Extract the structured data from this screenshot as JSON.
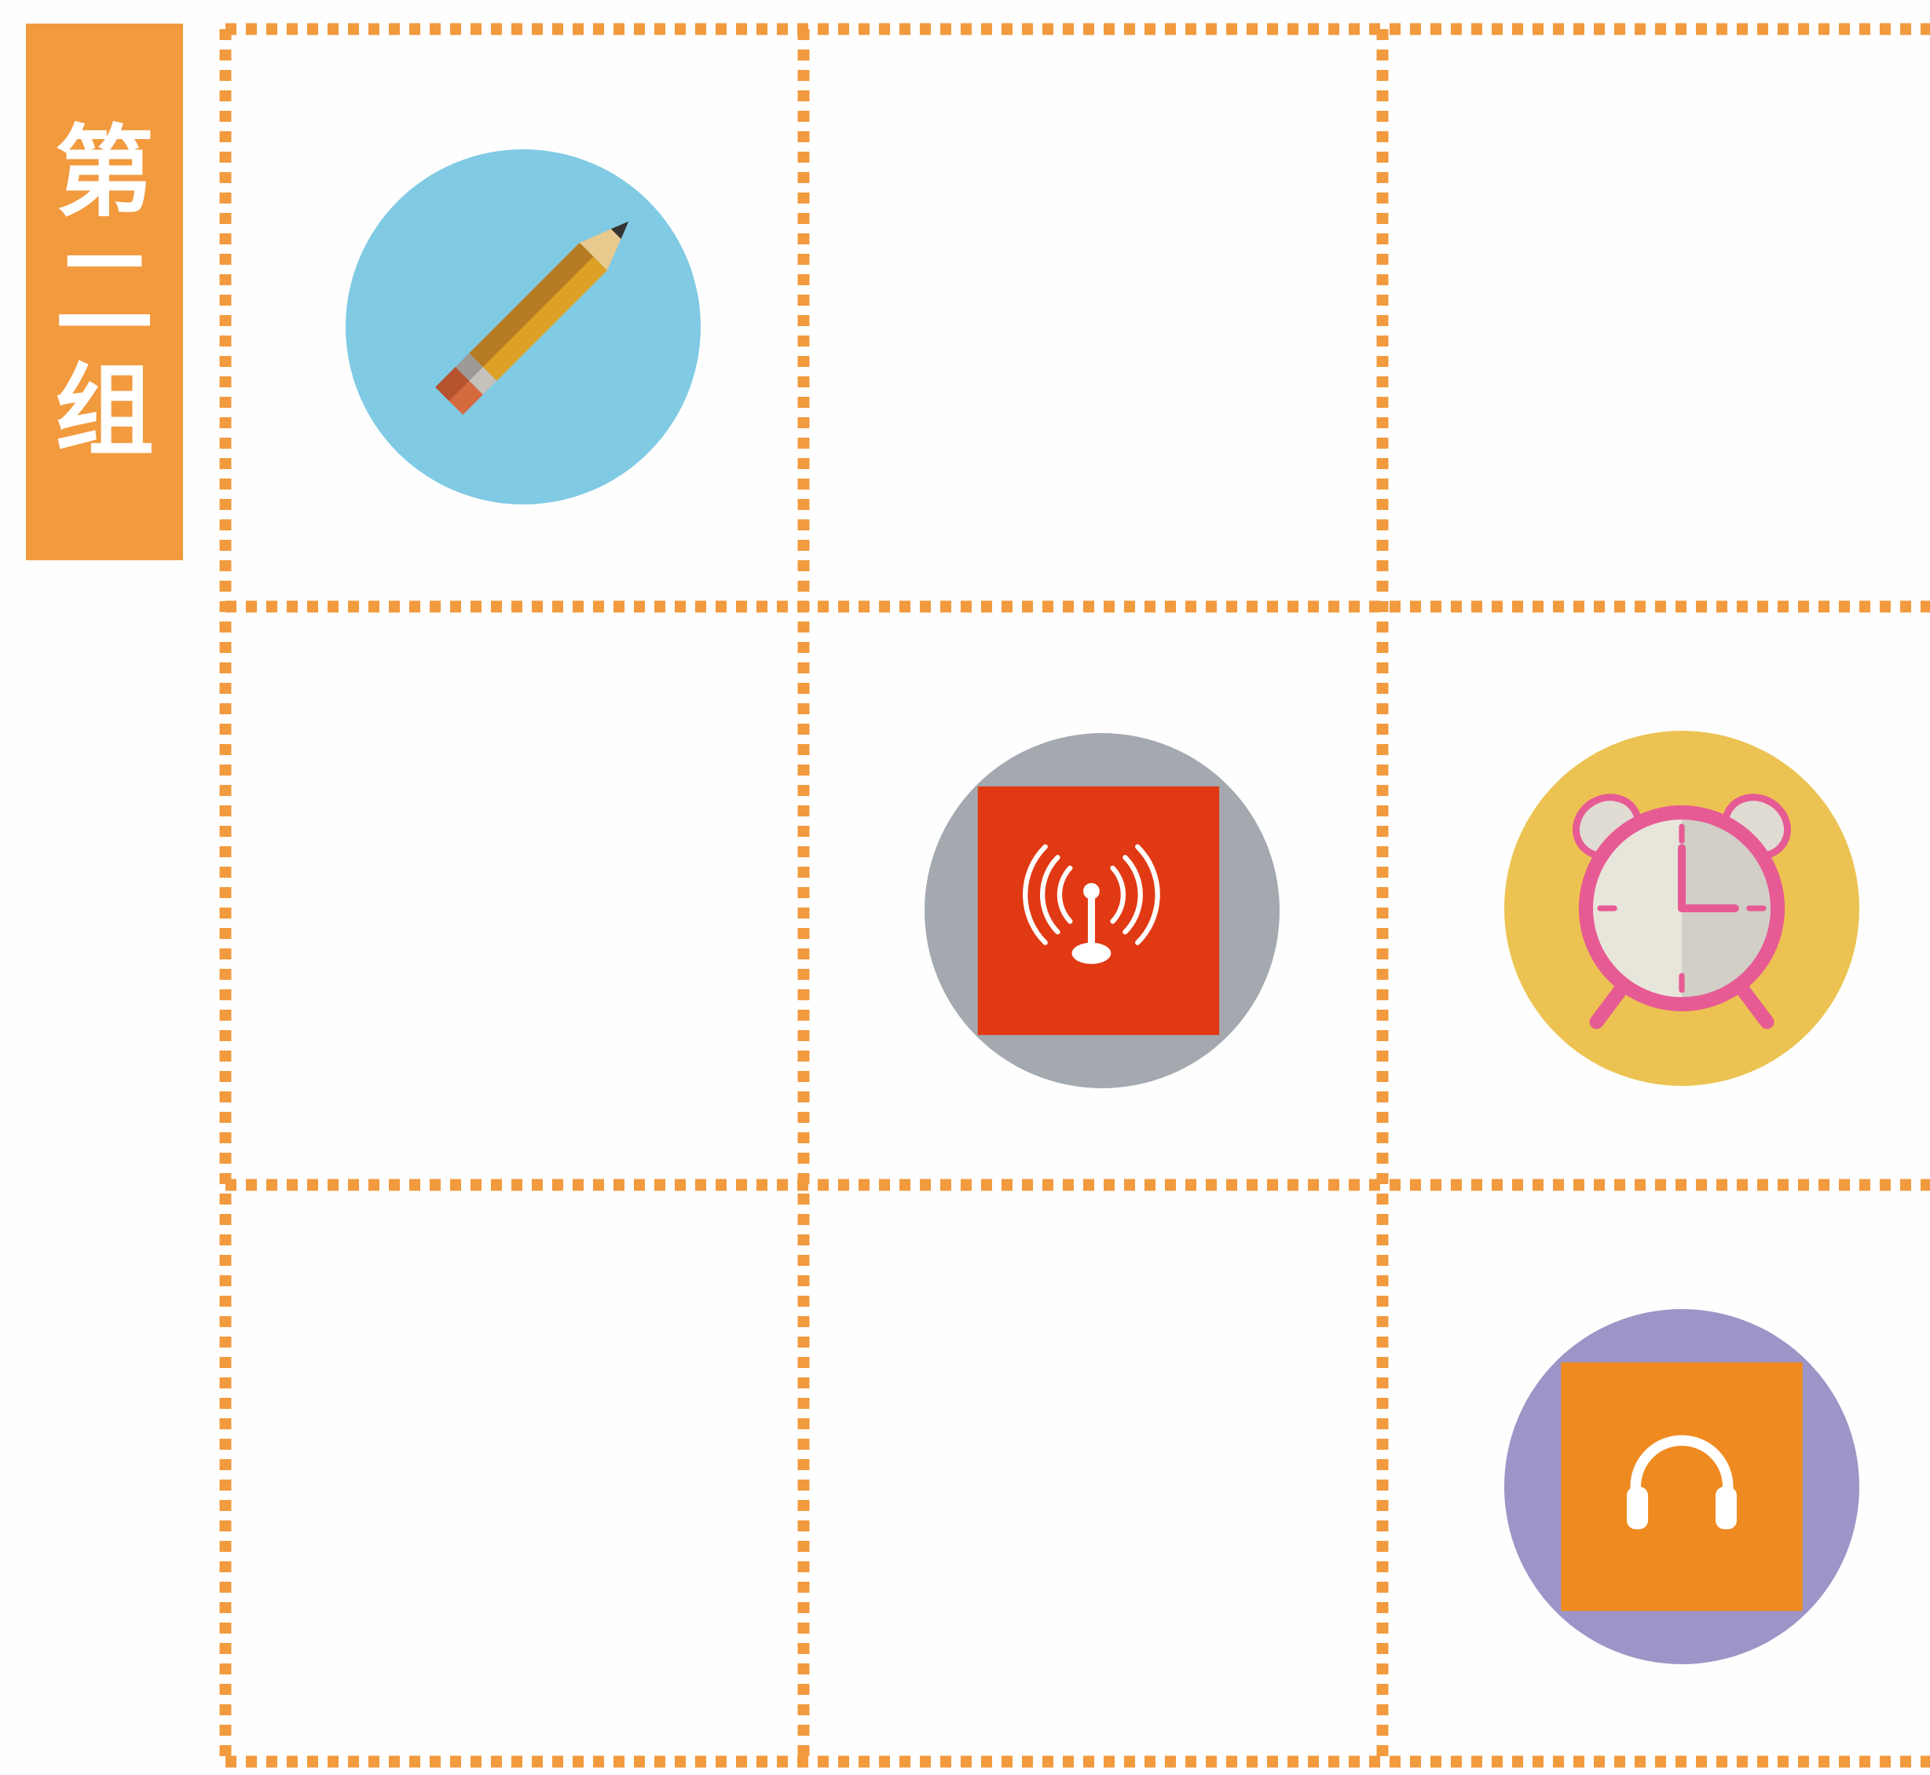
{
  "group_label": {
    "chars": [
      "第",
      "二",
      "组"
    ]
  },
  "icons": [
    {
      "name": "pencil-icon",
      "bg": "#80cae4"
    },
    {
      "name": "antenna-icon",
      "bg": "#a4a9b0",
      "tile": "#e13913"
    },
    {
      "name": "clock-icon",
      "bg": "#ecc352"
    },
    {
      "name": "headset-icon",
      "bg": "#9d95c7",
      "tile": "#ee8a1f"
    }
  ],
  "colors": {
    "accent": "#f29a3e",
    "background": "#fefefe"
  }
}
